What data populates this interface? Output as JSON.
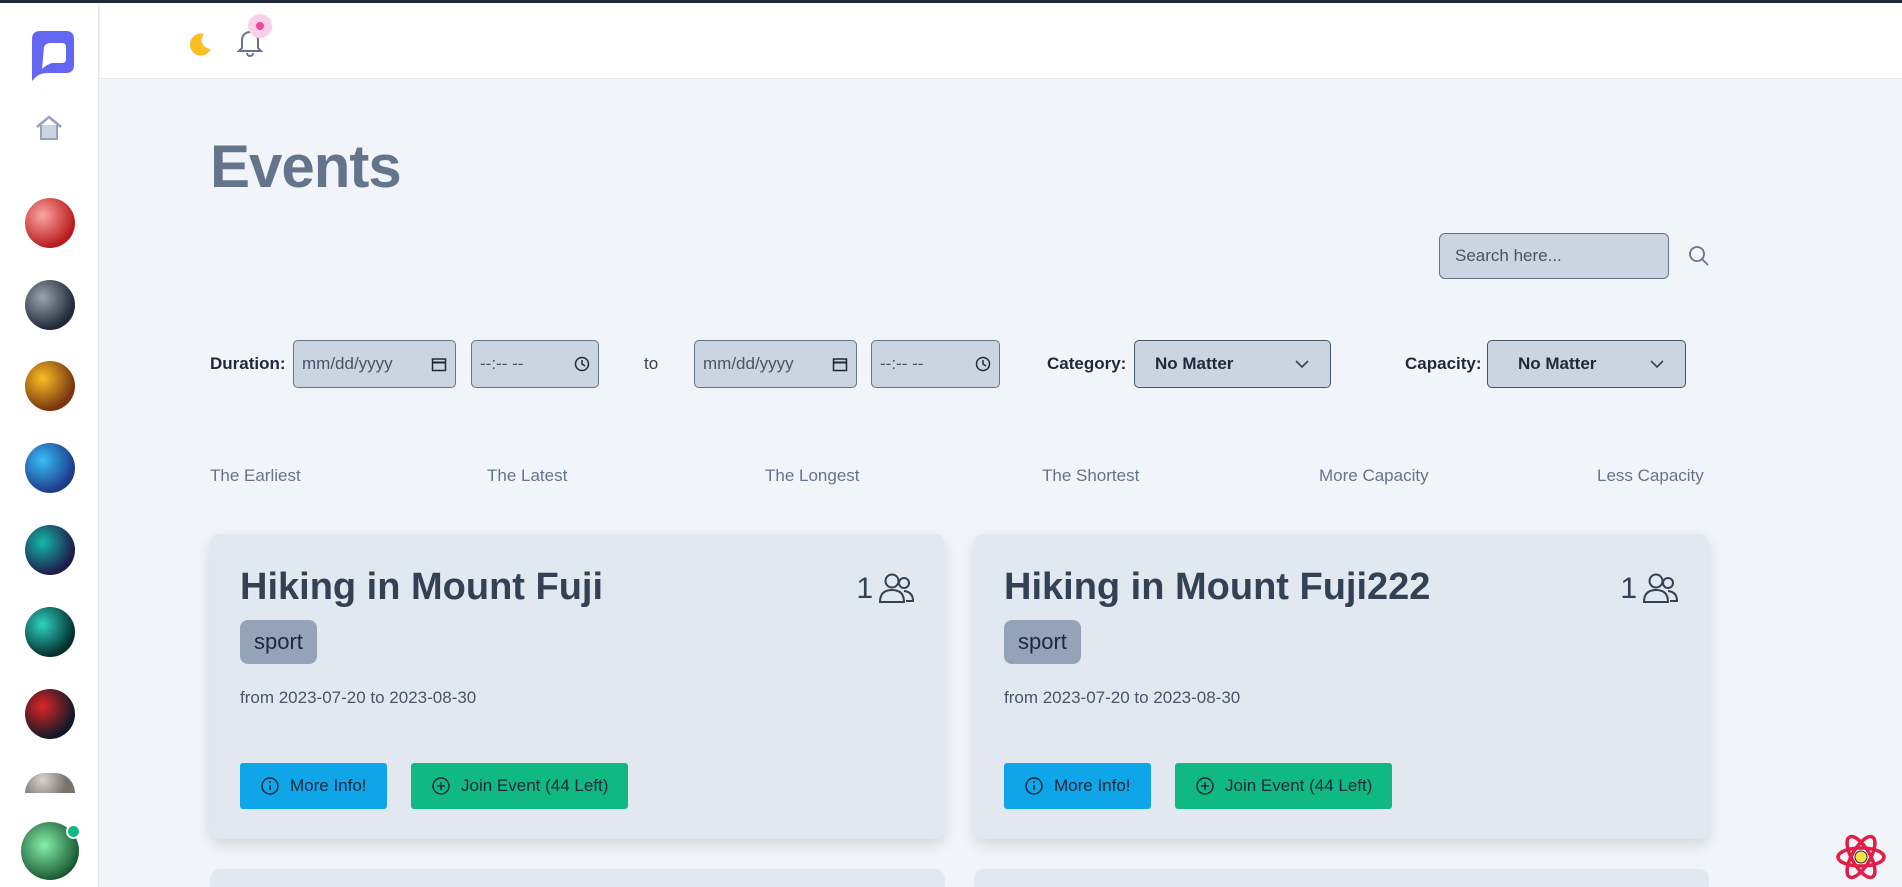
{
  "header": {
    "theme_icon": "moon-icon",
    "notification_icon": "bell-icon"
  },
  "sidebar": {
    "logo_icon": "app-logo-icon",
    "home_icon": "home-icon",
    "avatars": [
      {
        "colors": [
          "#b91c1c",
          "#fca5a5"
        ]
      },
      {
        "colors": [
          "#1f2937",
          "#9ca3af"
        ]
      },
      {
        "colors": [
          "#78350f",
          "#fbbf24"
        ]
      },
      {
        "colors": [
          "#1e3a8a",
          "#38bdf8"
        ]
      },
      {
        "colors": [
          "#1e1b4b",
          "#14b8a6"
        ]
      },
      {
        "colors": [
          "#042f2e",
          "#2dd4bf"
        ]
      },
      {
        "colors": [
          "#111827",
          "#dc2626"
        ]
      },
      {
        "colors": [
          "#78716c",
          "#d6d3d1"
        ]
      }
    ],
    "user_avatar": {
      "colors": [
        "#14532d",
        "#86efac"
      ],
      "online": true
    }
  },
  "page": {
    "title": "Events"
  },
  "search": {
    "placeholder": "Search here..."
  },
  "filters": {
    "duration_label": "Duration:",
    "date_placeholder": "mm/dd/yyyy",
    "time_placeholder": "--:-- --",
    "to_label": "to",
    "category_label": "Category:",
    "category_value": "No Matter",
    "capacity_label": "Capacity:",
    "capacity_value": "No Matter"
  },
  "sort_options": [
    "The Earliest",
    "The Latest",
    "The Longest",
    "The Shortest",
    "More Capacity",
    "Less Capacity"
  ],
  "events": [
    {
      "title": "Hiking in Mount Fuji",
      "participants": "1",
      "category": "sport",
      "dates": "from 2023-07-20 to 2023-08-30",
      "info_label": "More Info!",
      "join_label": "Join Event (44 Left)"
    },
    {
      "title": "Hiking in Mount Fuji222",
      "participants": "1",
      "category": "sport",
      "dates": "from 2023-07-20 to 2023-08-30",
      "info_label": "More Info!",
      "join_label": "Join Event (44 Left)"
    }
  ],
  "colors": {
    "brand": "#6366f1",
    "info": "#0ea5e9",
    "join": "#10b981",
    "notification": "#ec4899"
  }
}
